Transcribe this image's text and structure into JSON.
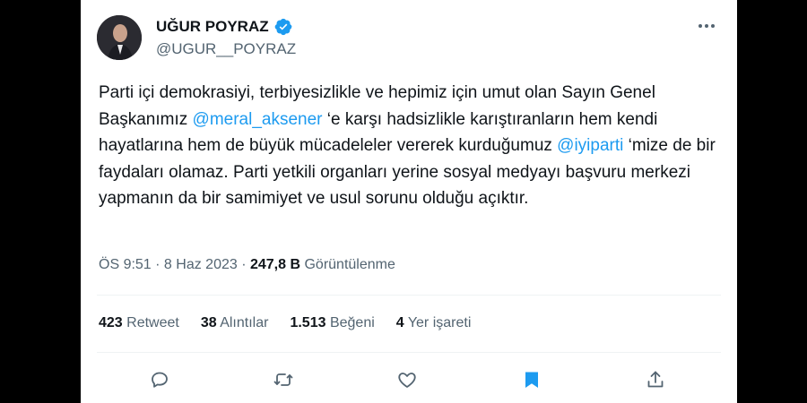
{
  "author": {
    "name": "UĞUR POYRAZ",
    "handle": "@UGUR__POYRAZ",
    "verified_icon": "verified-badge-icon",
    "avatar_icon": "avatar-photo"
  },
  "more_icon": "more-icon",
  "tweet": {
    "seg1": "Parti içi demokrasiyi, terbiyesizlikle ve hepimiz için umut olan Sayın Genel Başkanımız ",
    "mention1": "@meral_aksener",
    "seg2": " ‘e karşı  hadsizlikle karıştıranların hem kendi hayatlarına hem de büyük mücadeleler vererek kurduğumuz ",
    "mention2": "@iyiparti",
    "seg3": " ‘mize de bir faydaları olamaz. Parti yetkili organları yerine sosyal medyayı başvuru merkezi yapmanın da bir samimiyet ve usul sorunu olduğu açıktır."
  },
  "meta": {
    "time": "ÖS 9:51",
    "sep1": " · ",
    "date": "8 Haz 2023",
    "sep2": " · ",
    "views_count": "247,8 B",
    "views_label": " Görüntülenme"
  },
  "stats": {
    "retweets_count": "423",
    "retweets_label": " Retweet",
    "quotes_count": "38",
    "quotes_label": " Alıntılar",
    "likes_count": "1.513",
    "likes_label": " Beğeni",
    "bookmarks_count": "4",
    "bookmarks_label": " Yer işareti"
  },
  "actions": [
    "reply-icon",
    "retweet-icon",
    "like-icon",
    "bookmark-icon",
    "share-icon"
  ],
  "colors": {
    "accent": "#1d9bf0",
    "text": "#0f1419",
    "muted": "#536471"
  }
}
